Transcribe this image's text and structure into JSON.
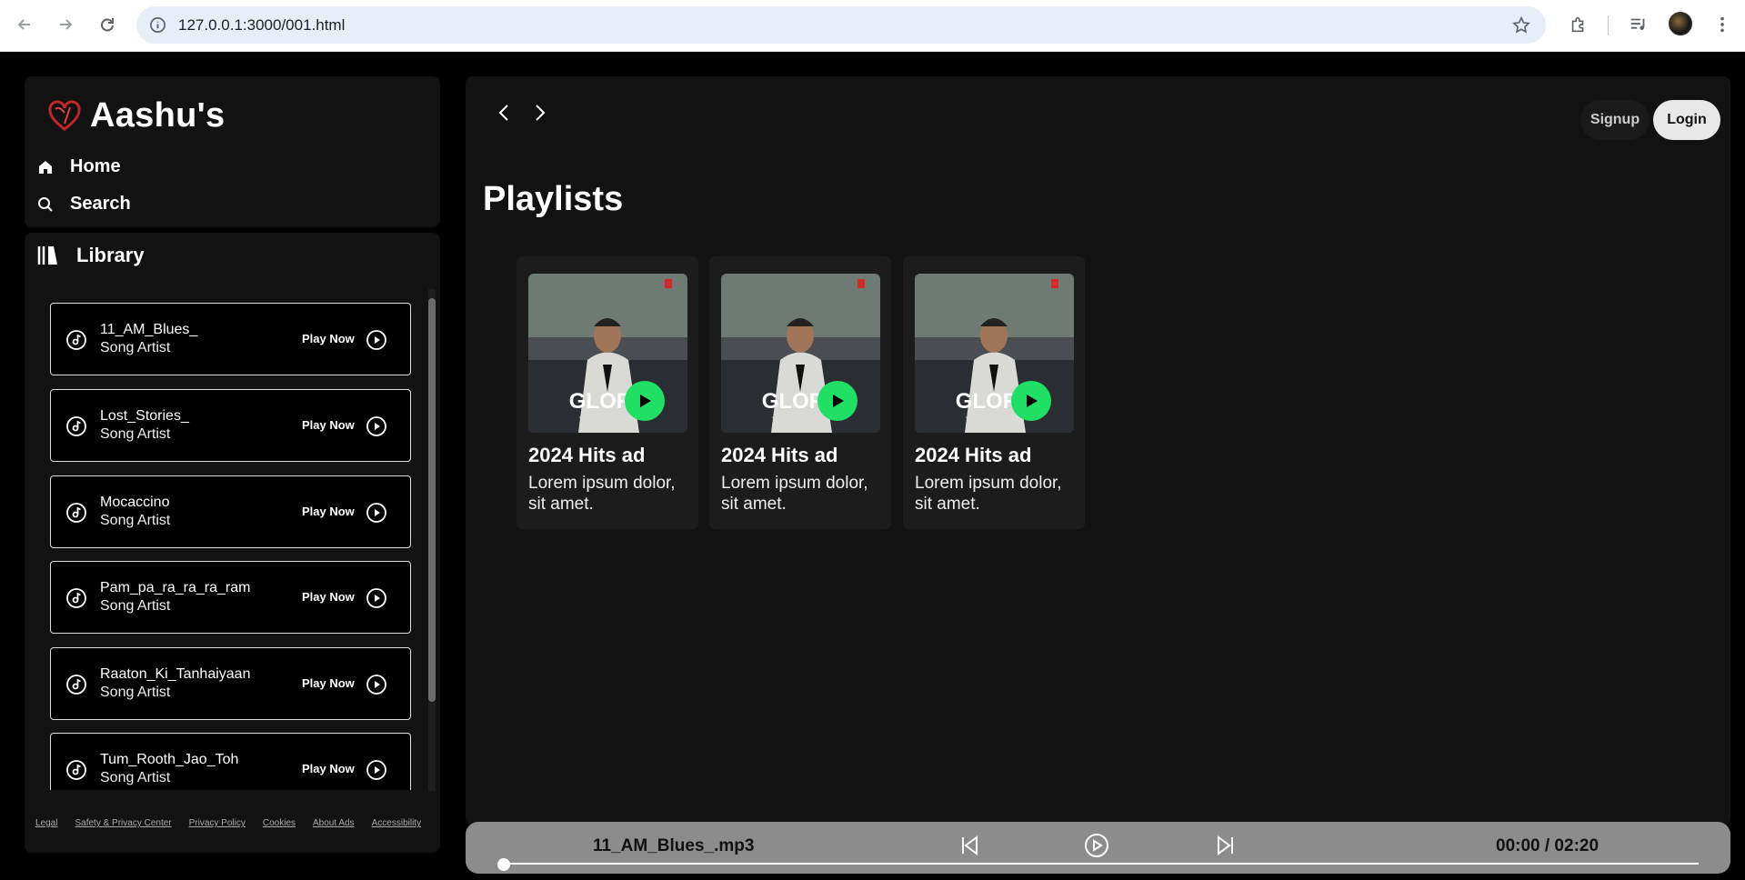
{
  "browser": {
    "url": "127.0.0.1:3000/001.html"
  },
  "sidebar": {
    "brand": "Aashu's",
    "nav": [
      {
        "label": "Home",
        "icon": "home-icon"
      },
      {
        "label": "Search",
        "icon": "search-icon"
      }
    ],
    "library_label": "Library",
    "songs": [
      {
        "name": "11_AM_Blues_",
        "artist": "Song Artist",
        "action": "Play Now"
      },
      {
        "name": "Lost_Stories_",
        "artist": "Song Artist",
        "action": "Play Now"
      },
      {
        "name": "Mocaccino",
        "artist": "Song Artist",
        "action": "Play Now"
      },
      {
        "name": "Pam_pa_ra_ra_ra_ram",
        "artist": "Song Artist",
        "action": "Play Now"
      },
      {
        "name": "Raaton_Ki_Tanhaiyaan",
        "artist": "Song Artist",
        "action": "Play Now"
      },
      {
        "name": "Tum_Rooth_Jao_Toh",
        "artist": "Song Artist",
        "action": "Play Now"
      }
    ],
    "footer": [
      "Legal",
      "Safety & Privacy Center",
      "Privacy Policy",
      "Cookies",
      "About Ads",
      "Accessibility"
    ]
  },
  "header": {
    "signup": "Signup",
    "login": "Login"
  },
  "main": {
    "title": "Playlists",
    "cards": [
      {
        "title": "2024 Hits ad",
        "desc": "Lorem ipsum dolor, sit amet."
      },
      {
        "title": "2024 Hits ad",
        "desc": "Lorem ipsum dolor, sit amet."
      },
      {
        "title": "2024 Hits ad",
        "desc": "Lorem ipsum dolor, sit amet."
      }
    ]
  },
  "player": {
    "track": "11_AM_Blues_.mp3",
    "time": "00:00 / 02:20",
    "progress": 0
  },
  "colors": {
    "accent_green": "#1fdf64",
    "background": "#121212",
    "player_bar": "#8c8c8c"
  }
}
